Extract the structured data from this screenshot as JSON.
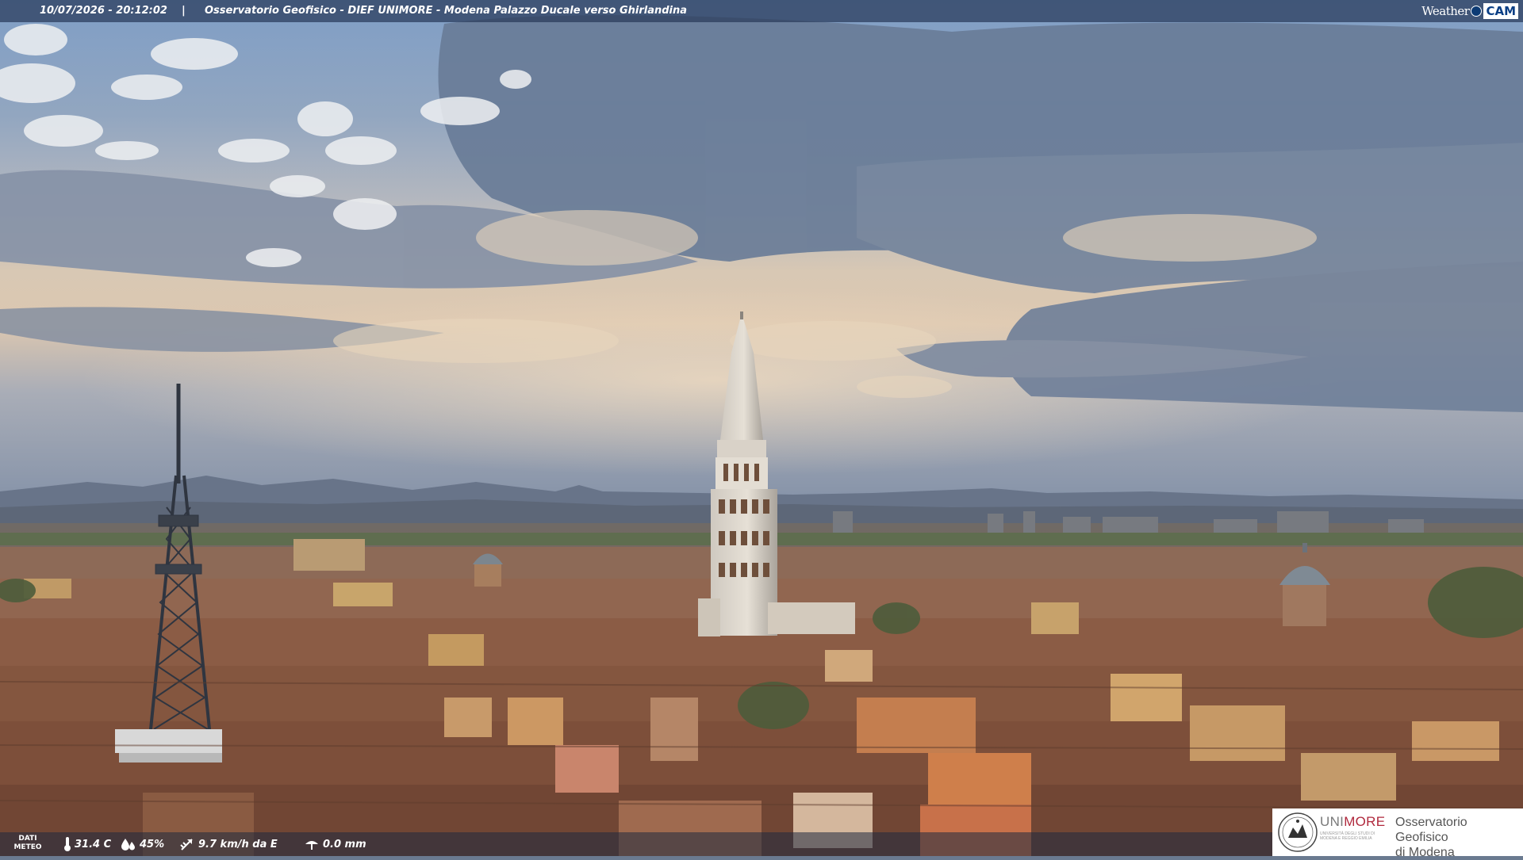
{
  "overlay": {
    "timestamp": "10/07/2026 - 20:12:02",
    "separator": "|",
    "title": "Osservatorio Geofisico - DIEF UNIMORE - Modena Palazzo Ducale verso Ghirlandina"
  },
  "brand": {
    "weather": "Weather",
    "cam": "CAM"
  },
  "weather_data": {
    "label": "DATI METEO",
    "temperature": "31.4 C",
    "humidity": "45%",
    "wind": "9.7 km/h da E",
    "rain": "0.0 mm",
    "icons": [
      "thermometer-icon",
      "humidity-drop-icon",
      "wind-icon",
      "rain-gauge-icon"
    ]
  },
  "logo": {
    "uni_name_prefix": "UNI",
    "uni_name_accent": "MORE",
    "uni_subtitle": "UNIVERSITÀ DEGLI STUDI DI MODENA E REGGIO EMILIA",
    "observatory_line1": "Osservatorio Geofisico",
    "observatory_line2": "di Modena"
  },
  "colors": {
    "overlay_bar": "#283a5a",
    "brand_blue": "#0b3f85",
    "unimore_red": "#b0293d"
  }
}
